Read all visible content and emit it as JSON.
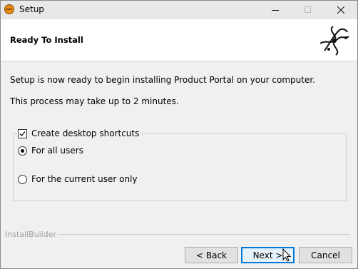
{
  "window": {
    "title": "Setup",
    "app_icon": "installer-app-icon"
  },
  "header": {
    "title": "Ready To Install",
    "logo": "bitrock-logo-icon"
  },
  "content": {
    "line1": "Setup is now ready to begin installing Product Portal on your computer.",
    "line2": "This process may take up to 2 minutes."
  },
  "shortcuts": {
    "label": "Create desktop shortcuts",
    "checked": true,
    "options": [
      {
        "label": "For all users",
        "selected": true
      },
      {
        "label": "For the current user only",
        "selected": false
      }
    ]
  },
  "footer": {
    "brand": "InstallBuilder",
    "back_label": "< Back",
    "next_label": "Next >",
    "cancel_label": "Cancel"
  },
  "colors": {
    "accent": "#0078d7",
    "header_bg": "#ffffff",
    "window_bg": "#f0f0f0"
  }
}
